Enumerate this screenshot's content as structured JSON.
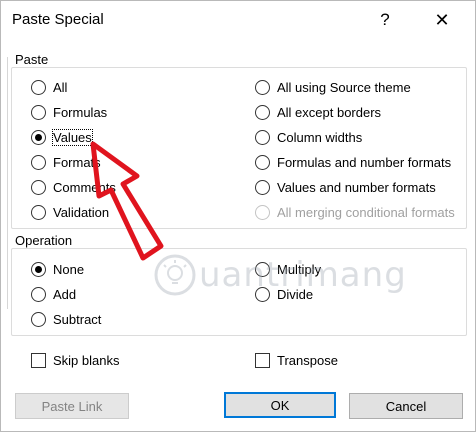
{
  "dialog": {
    "title": "Paste Special",
    "help": "?",
    "close": "✕"
  },
  "paste": {
    "label": "Paste",
    "left": [
      {
        "label": "All",
        "checked": false,
        "disabled": false
      },
      {
        "label": "Formulas",
        "checked": false,
        "disabled": false
      },
      {
        "label": "Values",
        "checked": true,
        "disabled": false
      },
      {
        "label": "Formats",
        "checked": false,
        "disabled": false
      },
      {
        "label": "Comments",
        "checked": false,
        "disabled": false
      },
      {
        "label": "Validation",
        "checked": false,
        "disabled": false
      }
    ],
    "right": [
      {
        "label": "All using Source theme",
        "checked": false,
        "disabled": false
      },
      {
        "label": "All except borders",
        "checked": false,
        "disabled": false
      },
      {
        "label": "Column widths",
        "checked": false,
        "disabled": false
      },
      {
        "label": "Formulas and number formats",
        "checked": false,
        "disabled": false
      },
      {
        "label": "Values and number formats",
        "checked": false,
        "disabled": false
      },
      {
        "label": "All merging conditional formats",
        "checked": false,
        "disabled": true
      }
    ]
  },
  "operation": {
    "label": "Operation",
    "left": [
      {
        "label": "None",
        "checked": true
      },
      {
        "label": "Add",
        "checked": false
      },
      {
        "label": "Subtract",
        "checked": false
      }
    ],
    "right": [
      {
        "label": "Multiply",
        "checked": false
      },
      {
        "label": "Divide",
        "checked": false
      }
    ]
  },
  "options": {
    "skip_blanks": "Skip blanks",
    "transpose": "Transpose"
  },
  "buttons": {
    "paste_link": "Paste Link",
    "ok": "OK",
    "cancel": "Cancel"
  },
  "watermark": {
    "text": "uantrimang"
  },
  "colors": {
    "arrow": "#e0141e",
    "default_button_border": "#0078d7"
  }
}
